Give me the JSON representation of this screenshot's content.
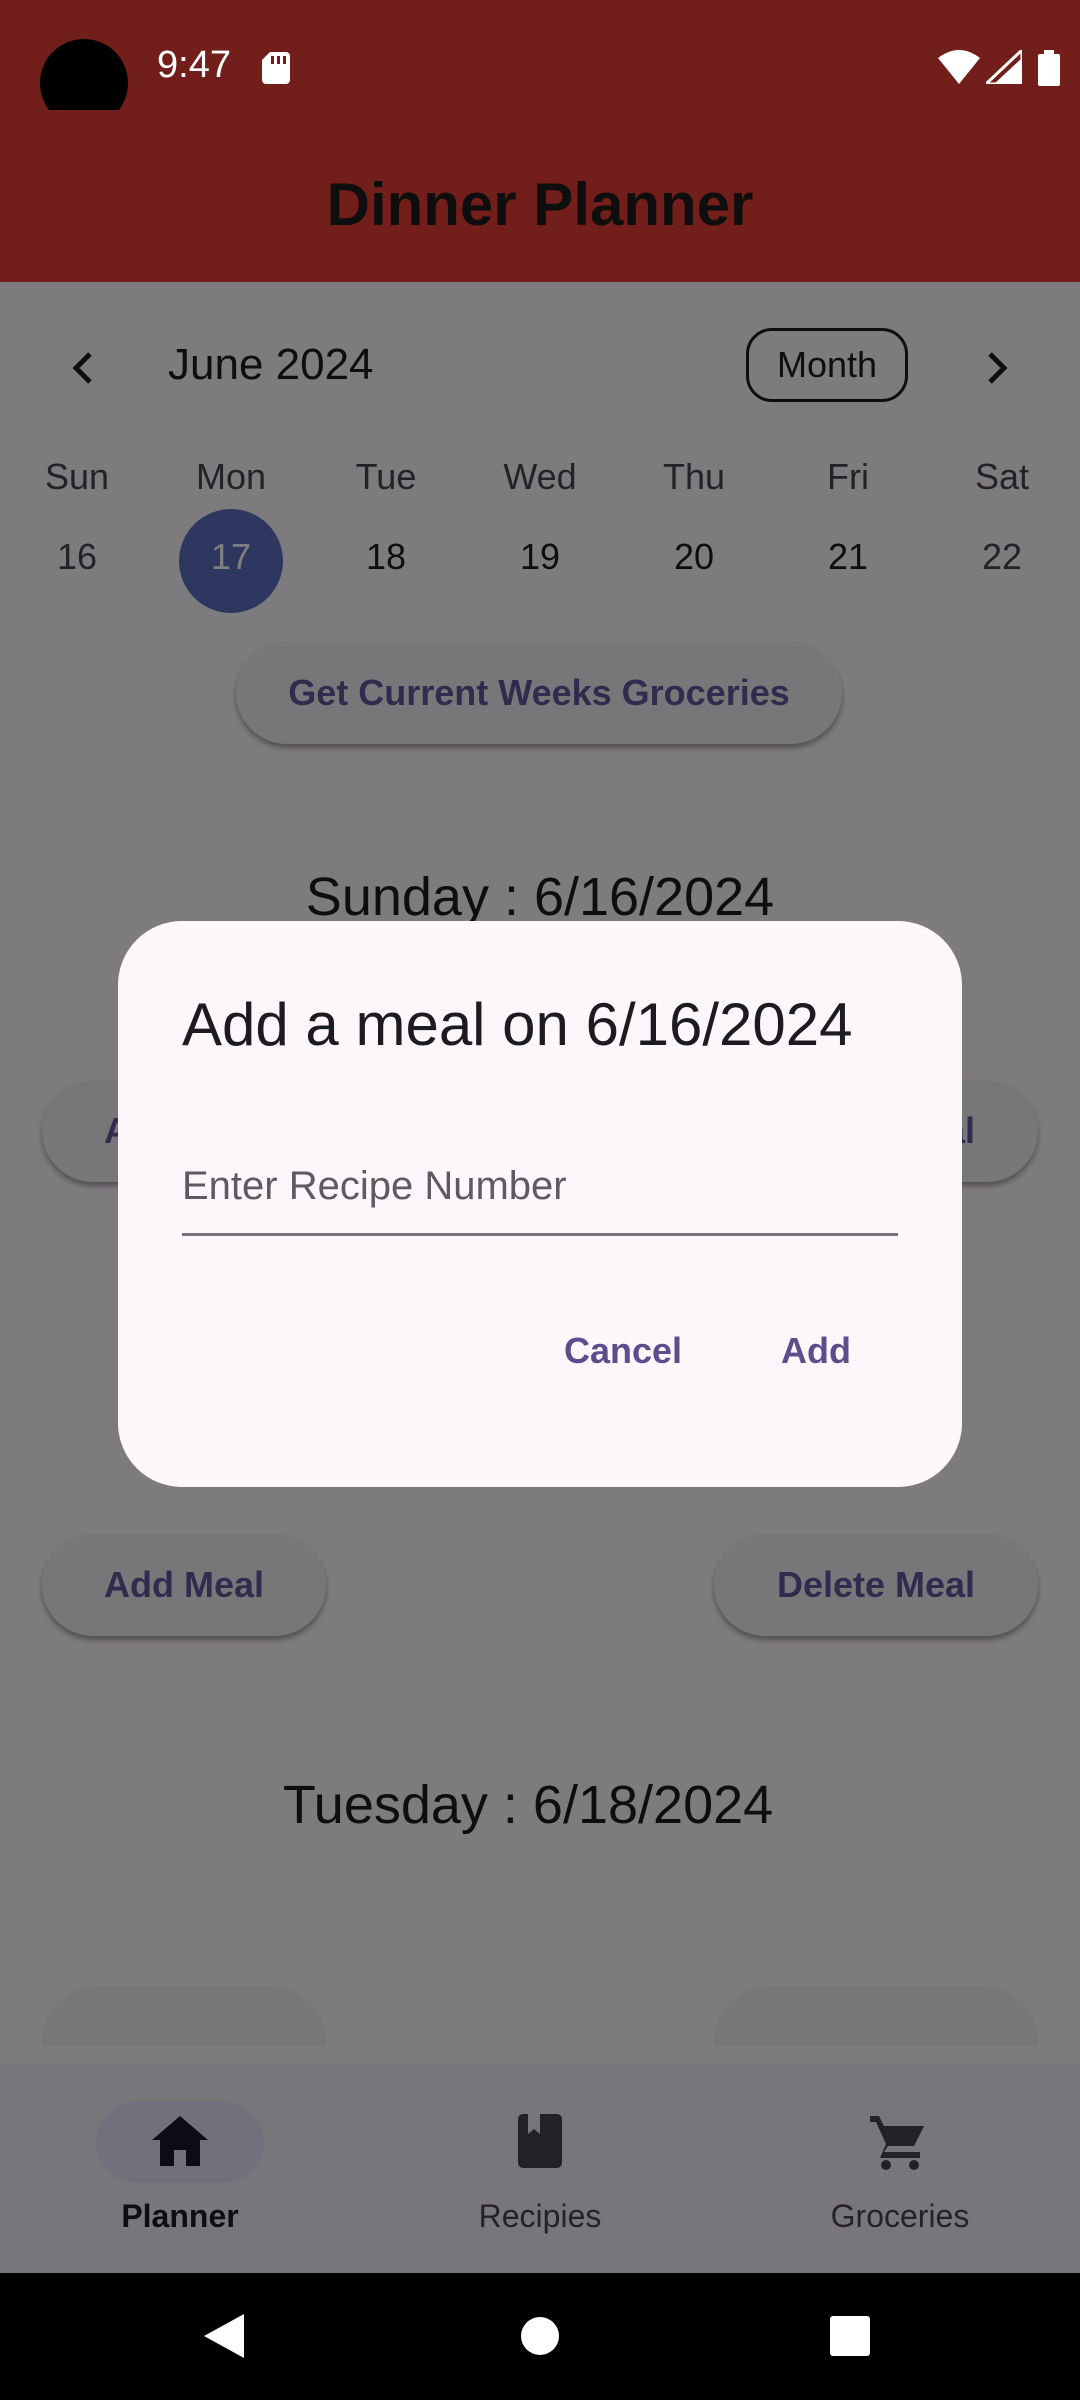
{
  "status_bar": {
    "time": "9:47"
  },
  "app_bar": {
    "title": "Dinner Planner"
  },
  "calendar": {
    "month_label": "June 2024",
    "format_button": "Month",
    "weekdays": [
      "Sun",
      "Mon",
      "Tue",
      "Wed",
      "Thu",
      "Fri",
      "Sat"
    ],
    "days": [
      "16",
      "17",
      "18",
      "19",
      "20",
      "21",
      "22"
    ],
    "selected_day": "17"
  },
  "groceries_button": "Get Current Weeks Groceries",
  "sections": [
    {
      "heading": "Sunday : 6/16/2024",
      "add_label": "Add Meal",
      "delete_label": "Delete Meal"
    },
    {
      "add_label": "Add Meal",
      "delete_label": "Delete Meal"
    },
    {
      "heading": "Tuesday : 6/18/2024"
    }
  ],
  "dialog": {
    "title": "Add a meal on 6/16/2024",
    "input_placeholder": "Enter Recipe Number",
    "input_value": "",
    "cancel_label": "Cancel",
    "add_label": "Add"
  },
  "bottom_nav": {
    "items": [
      {
        "label": "Planner",
        "icon": "home-icon",
        "selected": true
      },
      {
        "label": "Recipies",
        "icon": "book-icon",
        "selected": false
      },
      {
        "label": "Groceries",
        "icon": "cart-icon",
        "selected": false
      }
    ]
  },
  "colors": {
    "app_bar": "#721f1b",
    "accent": "#5a4e8c",
    "selected_day": "#5a6fc1"
  }
}
